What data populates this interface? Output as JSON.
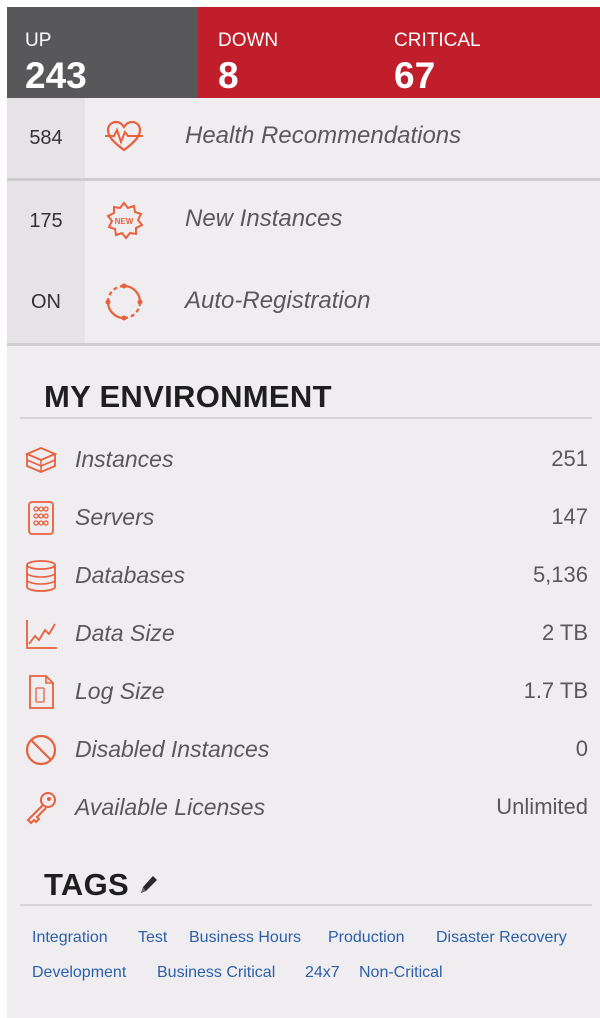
{
  "status": {
    "up": {
      "label": "UP",
      "value": "243"
    },
    "down": {
      "label": "DOWN",
      "value": "8"
    },
    "critical": {
      "label": "CRITICAL",
      "value": "67"
    }
  },
  "summary": [
    {
      "count": "584",
      "label": "Health Recommendations",
      "icon": "heartbeat-icon"
    },
    {
      "count": "175",
      "label": "New Instances",
      "icon": "new-badge-icon"
    },
    {
      "count": "ON",
      "label": "Auto-Registration",
      "icon": "refresh-cycle-icon"
    }
  ],
  "environment": {
    "title": "MY ENVIRONMENT",
    "items": [
      {
        "label": "Instances",
        "value": "251",
        "icon": "instances-icon"
      },
      {
        "label": "Servers",
        "value": "147",
        "icon": "server-icon"
      },
      {
        "label": "Databases",
        "value": "5,136",
        "icon": "database-icon"
      },
      {
        "label": "Data Size",
        "value": "2 TB",
        "icon": "chart-line-icon"
      },
      {
        "label": "Log Size",
        "value": "1.7 TB",
        "icon": "log-file-icon"
      },
      {
        "label": "Disabled Instances",
        "value": "0",
        "icon": "disabled-icon"
      },
      {
        "label": "Available Licenses",
        "value": "Unlimited",
        "icon": "key-icon"
      }
    ]
  },
  "tags": {
    "title": "TAGS",
    "items": [
      "Integration",
      "Test",
      "Business Hours",
      "Production",
      "Disaster Recovery",
      "Development",
      "Business Critical",
      "24x7",
      "Non-Critical"
    ]
  },
  "colors": {
    "up_bg": "#58585a",
    "alert_bg": "#c01e2a",
    "panel_bg": "#efedf0",
    "icon_accent": "#e8603c",
    "tag_link": "#2b5fa8"
  }
}
